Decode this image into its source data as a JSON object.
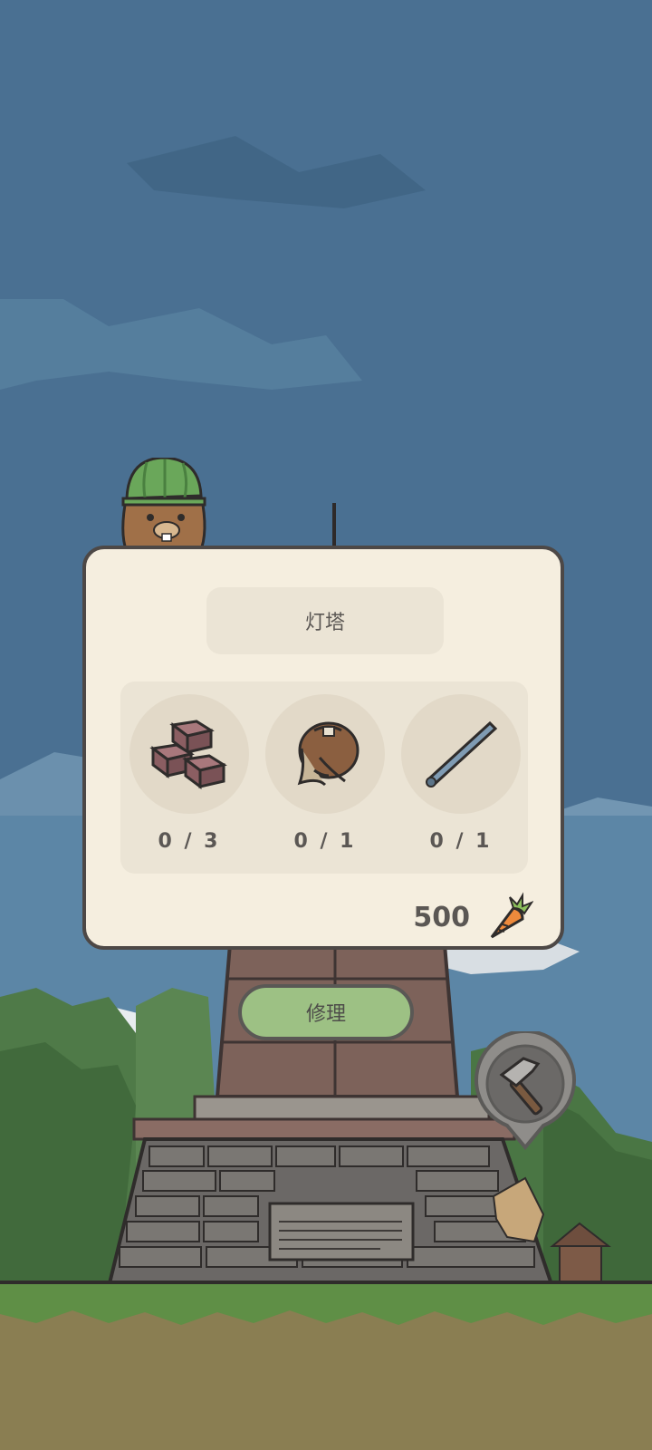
{
  "dialog": {
    "title": "灯塔",
    "materials": [
      {
        "icon": "brick-stack-icon",
        "count": "0 / 3"
      },
      {
        "icon": "rope-sack-icon",
        "count": "0 / 1"
      },
      {
        "icon": "metal-rod-icon",
        "count": "0 / 1"
      }
    ],
    "cost": "500",
    "cost_icon": "carrot-icon"
  },
  "repair_button": {
    "label": "修理"
  },
  "map_marker": {
    "icon": "hammer-icon"
  },
  "colors": {
    "sky": "#4a7092",
    "panel": "#f5eedf",
    "button": "#9dc184",
    "ground": "#8a7e52"
  }
}
